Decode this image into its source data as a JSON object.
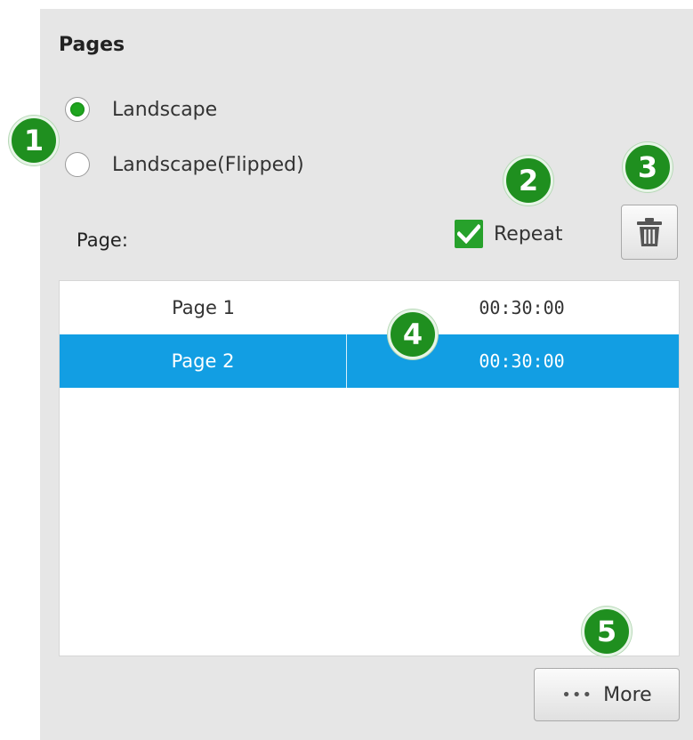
{
  "section": {
    "title": "Pages"
  },
  "orientation": {
    "options": [
      {
        "label": "Landscape",
        "selected": true
      },
      {
        "label": "Landscape(Flipped)",
        "selected": false
      }
    ]
  },
  "page_field": {
    "label": "Page:"
  },
  "repeat": {
    "label": "Repeat",
    "checked": true
  },
  "delete_button": {
    "icon": "trash-icon"
  },
  "pages_list": {
    "rows": [
      {
        "name": "Page 1",
        "duration": "00:30:00",
        "selected": false
      },
      {
        "name": "Page 2",
        "duration": "00:30:00",
        "selected": true
      }
    ]
  },
  "more_button": {
    "dots": "•••",
    "label": "More",
    "icon": "ellipsis-icon"
  },
  "badges": [
    "1",
    "2",
    "3",
    "4",
    "5"
  ],
  "colors": {
    "accent_green": "#1fa51f",
    "selection_blue": "#129ee3",
    "badge_green": "#1f8f1f"
  }
}
